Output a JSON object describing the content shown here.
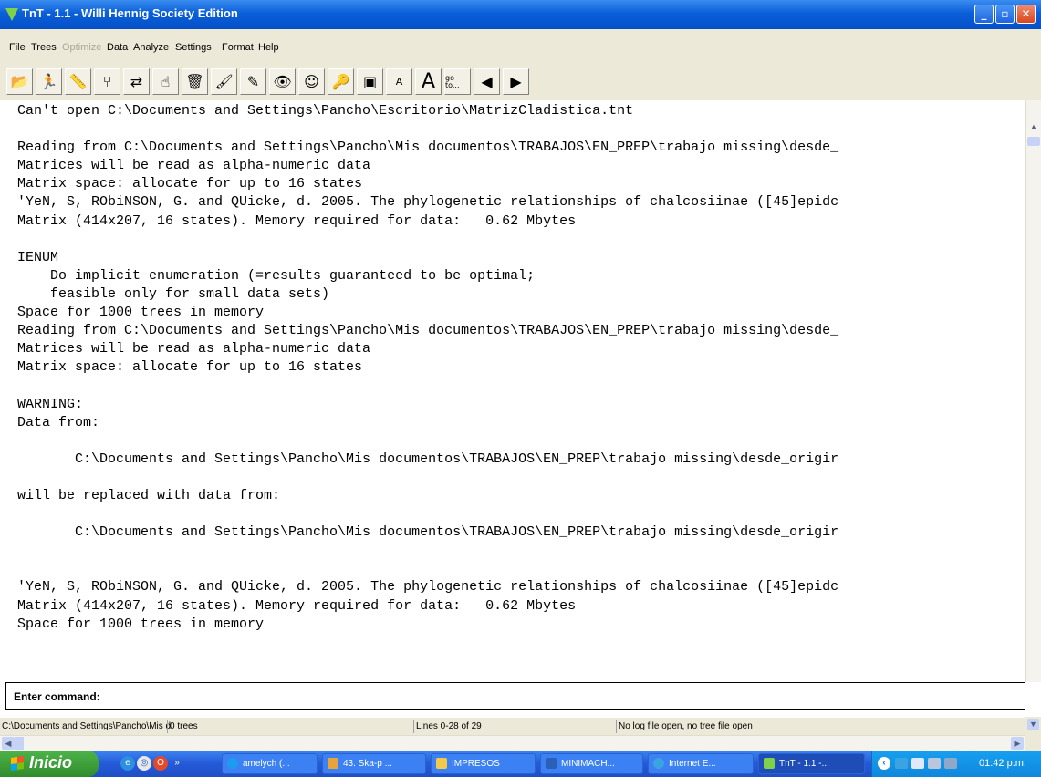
{
  "window": {
    "title": "TnT - 1.1 - Willi Hennig Society Edition",
    "buttons": {
      "minimize": "_",
      "maximize": "▫",
      "close": "✕"
    }
  },
  "menu": [
    {
      "label": "File",
      "enabled": true
    },
    {
      "label": "Trees",
      "enabled": true
    },
    {
      "label": "Optimize",
      "enabled": false
    },
    {
      "label": "Data",
      "enabled": true
    },
    {
      "label": "Analyze",
      "enabled": true
    },
    {
      "label": "Settings",
      "enabled": true
    },
    {
      "label": "Format",
      "enabled": true
    },
    {
      "label": "Help",
      "enabled": true
    }
  ],
  "toolbar": [
    {
      "icon": "open-file-icon",
      "glyph": "📂"
    },
    {
      "icon": "runner-icon",
      "glyph": "🏃"
    },
    {
      "icon": "ruler-icon",
      "glyph": "📏"
    },
    {
      "icon": "tree-icon",
      "glyph": "⑂"
    },
    {
      "icon": "tree-swap-icon",
      "glyph": "⇄"
    },
    {
      "icon": "tree-hand-icon",
      "glyph": "☝"
    },
    {
      "icon": "tree-trash-icon",
      "glyph": "🗑"
    },
    {
      "icon": "brush-icon",
      "glyph": "🖌"
    },
    {
      "icon": "tree-edit-icon",
      "glyph": "✎"
    },
    {
      "icon": "tree-view-icon",
      "glyph": "👁"
    },
    {
      "icon": "person-icon",
      "glyph": "☺"
    },
    {
      "icon": "key-icon",
      "glyph": "🔑"
    },
    {
      "icon": "window-icon",
      "glyph": "▣"
    },
    {
      "icon": "font-small-icon",
      "glyph": "A"
    },
    {
      "icon": "font-large-icon",
      "glyph": "A"
    },
    {
      "icon": "goto-icon",
      "glyph": "go to..."
    },
    {
      "icon": "back-arrow-icon",
      "glyph": "◀"
    },
    {
      "icon": "forward-arrow-icon",
      "glyph": "▶"
    }
  ],
  "output_text": "Can't open C:\\Documents and Settings\\Pancho\\Escritorio\\MatrizCladistica.tnt\n\nReading from C:\\Documents and Settings\\Pancho\\Mis documentos\\TRABAJOS\\EN_PREP\\trabajo missing\\desde_\nMatrices will be read as alpha-numeric data\nMatrix space: allocate for up to 16 states\n'YeN, S, RObiNSON, G. and QUicke, d. 2005. The phylogenetic relationships of chalcosiinae ([45]epidc\nMatrix (414x207, 16 states). Memory required for data:   0.62 Mbytes\n\nIENUM\n    Do implicit enumeration (=results guaranteed to be optimal;\n    feasible only for small data sets)\nSpace for 1000 trees in memory\nReading from C:\\Documents and Settings\\Pancho\\Mis documentos\\TRABAJOS\\EN_PREP\\trabajo missing\\desde_\nMatrices will be read as alpha-numeric data\nMatrix space: allocate for up to 16 states\n\nWARNING:\nData from:\n\n       C:\\Documents and Settings\\Pancho\\Mis documentos\\TRABAJOS\\EN_PREP\\trabajo missing\\desde_origir\n\nwill be replaced with data from:\n\n       C:\\Documents and Settings\\Pancho\\Mis documentos\\TRABAJOS\\EN_PREP\\trabajo missing\\desde_origir\n\n\n'YeN, S, RObiNSON, G. and QUicke, d. 2005. The phylogenetic relationships of chalcosiinae ([45]epidc\nMatrix (414x207, 16 states). Memory required for data:   0.62 Mbytes\nSpace for 1000 trees in memory",
  "command": {
    "label": "Enter command:"
  },
  "status": {
    "path": "C:\\Documents and Settings\\Pancho\\Mis d",
    "trees": "0 trees",
    "lines": "Lines 0-28 of 29",
    "log": "No log file open, no tree file open"
  },
  "taskbar": {
    "start_label": "Inicio",
    "overflow": "»",
    "tasks": [
      {
        "label": "amelych (...",
        "icon_color": "#1d9bf0"
      },
      {
        "label": "43. Ska-p ...",
        "icon_color": "#e8a33a"
      },
      {
        "label": "IMPRESOS",
        "icon_color": "#f2c94c"
      },
      {
        "label": "MINIMACH...",
        "icon_color": "#2b5fb8"
      },
      {
        "label": "Internet E...",
        "icon_color": "#3aa3e3"
      },
      {
        "label": "TnT - 1.1 -...",
        "icon_color": "#7fd14a"
      }
    ],
    "clock": "01:42 p.m."
  },
  "colors": {
    "titlebar": "#0a5fd8",
    "chrome": "#ece9d8",
    "taskbar": "#2459d8",
    "start_button": "#3a9b35"
  }
}
